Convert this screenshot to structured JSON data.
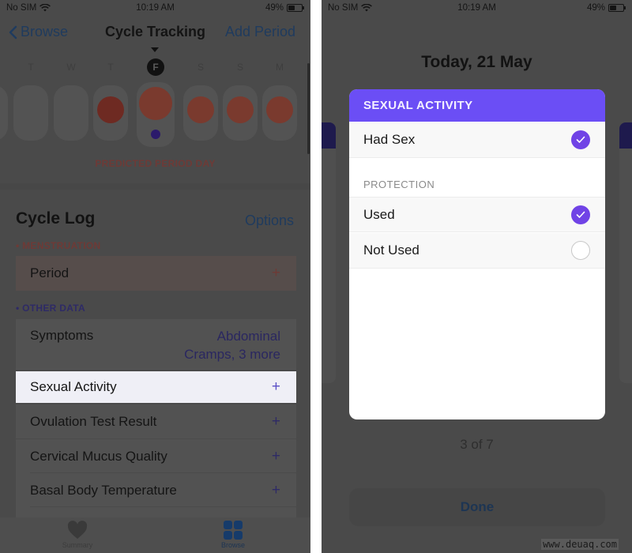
{
  "left_screen": {
    "status": {
      "carrier": "No SIM",
      "time": "10:19 AM",
      "battery": "49%"
    },
    "nav": {
      "back_label": "Browse",
      "title": "Cycle Tracking",
      "action_label": "Add Period"
    },
    "days": [
      {
        "label": "T",
        "selected": false
      },
      {
        "label": "W",
        "selected": false
      },
      {
        "label": "T",
        "selected": false
      },
      {
        "label": "F",
        "selected": true
      },
      {
        "label": "S",
        "selected": false
      },
      {
        "label": "S",
        "selected": false
      },
      {
        "label": "M",
        "selected": false
      }
    ],
    "day_cells": [
      {
        "period": "none",
        "fertility": false
      },
      {
        "period": "none",
        "fertility": false
      },
      {
        "period": "logged",
        "fertility": false
      },
      {
        "period": "predicted",
        "fertility": true
      },
      {
        "period": "predicted",
        "fertility": false
      },
      {
        "period": "predicted",
        "fertility": false
      },
      {
        "period": "predicted",
        "fertility": false
      }
    ],
    "predicted_label": "PREDICTED PERIOD DAY",
    "cycle_log": {
      "title": "Cycle Log",
      "options_label": "Options",
      "menstruation_label": "• MENSTRUATION",
      "period_label": "Period",
      "other_label": "• OTHER DATA",
      "symptoms": {
        "label": "Symptoms",
        "value_line1": "Abdominal",
        "value_line2": "Cramps, 3 more"
      },
      "rows": [
        {
          "label": "Sexual Activity",
          "action": "+"
        },
        {
          "label": "Ovulation Test Result",
          "action": "+"
        },
        {
          "label": "Cervical Mucus Quality",
          "action": "+"
        },
        {
          "label": "Basal Body Temperature",
          "action": "+"
        }
      ],
      "add_symbol": "+"
    },
    "tabbar": {
      "summary_label": "Summary",
      "browse_label": "Browse"
    }
  },
  "right_screen": {
    "status": {
      "carrier": "No SIM",
      "time": "10:19 AM",
      "battery": "49%"
    },
    "date_title": "Today, 21 May",
    "modal": {
      "header": "SEXUAL ACTIVITY",
      "had_sex": {
        "label": "Had Sex",
        "checked": true
      },
      "protection_label": "PROTECTION",
      "options": [
        {
          "label": "Used",
          "checked": true
        },
        {
          "label": "Not Used",
          "checked": false
        }
      ]
    },
    "pager": "3 of 7",
    "done_label": "Done"
  },
  "watermark": "www.deuaq.com",
  "colors": {
    "accent_purple": "#6b4ef5",
    "check_purple": "#7043e6",
    "period_red": "#6e2a22",
    "predicted_red": "#7a3a2e",
    "dim_overlay": "#4a4a4a"
  }
}
